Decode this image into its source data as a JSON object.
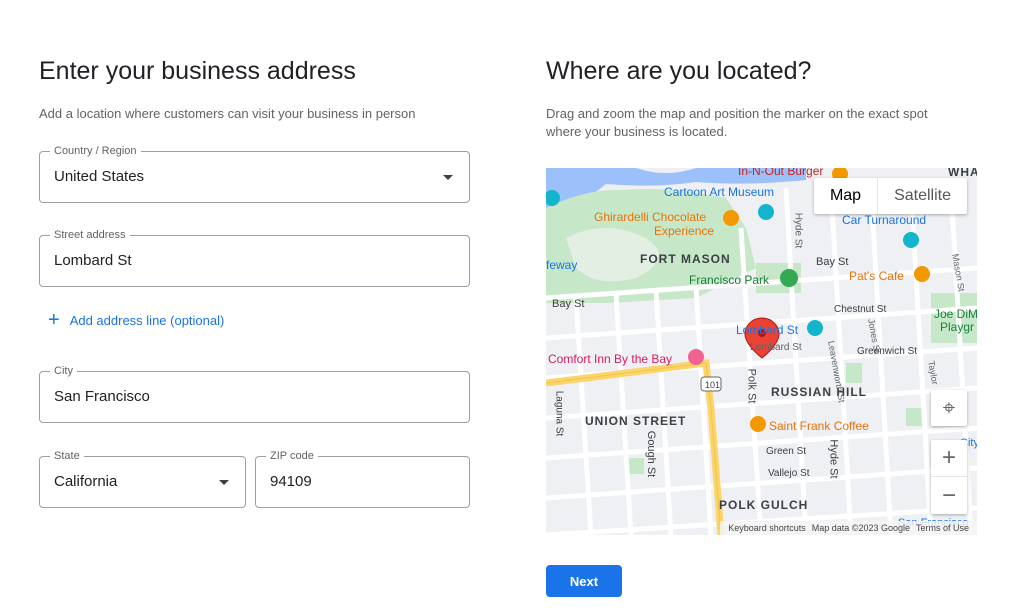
{
  "left": {
    "title": "Enter your business address",
    "subtitle": "Add a location where customers can visit your business in person",
    "country": {
      "label": "Country / Region",
      "value": "United States"
    },
    "street": {
      "label": "Street address",
      "value": "Lombard St"
    },
    "add_line": "Add address line (optional)",
    "city": {
      "label": "City",
      "value": "San Francisco"
    },
    "state": {
      "label": "State",
      "value": "California"
    },
    "zip": {
      "label": "ZIP code",
      "value": "94109"
    }
  },
  "right": {
    "title": "Where are you located?",
    "subtitle": "Drag and zoom the map and position the marker on the exact spot where your business is located.",
    "map": {
      "toggle_map": "Map",
      "toggle_satellite": "Satellite",
      "labels": {
        "in_n_out": "In-N-Out Burger",
        "cartoon": "Cartoon Art Museum",
        "wha": "WHA",
        "ghirardelli_1": "Ghirardelli Chocolate",
        "ghirardelli_2": "Experience",
        "car_turnaround": "Car Turnaround",
        "feway": "feway",
        "fort_mason": "FORT MASON",
        "bay_st_1": "Bay St",
        "francisco_park": "Francisco Park",
        "pats_cafe": "Pat's Cafe",
        "bay_st_2": "Bay St",
        "chestnut": "Chestnut St",
        "lombard_1": "Lombard St",
        "lombard_2": "Lombard St",
        "joe": "Joe DiM",
        "playg": "Playgr",
        "comfort_inn": "Comfort Inn By the Bay",
        "greenwich": "Greenwich St",
        "hwy": "101",
        "polk_st": "Polk St",
        "russian_hill": "RUSSIAN HILL",
        "laguna": "Laguna St",
        "union_street": "UNION STREET",
        "saint_frank": "Saint Frank Coffee",
        "gough": "Gough St",
        "green_st": "Green St",
        "hyde_st": "Hyde St",
        "hyde_st_top": "Hyde St",
        "vallejo": "Vallejo St",
        "leavenworth": "Leavenworth St",
        "jones": "Jones St",
        "mason": "Mason St",
        "taylor": "Taylor",
        "polk_gulch": "POLK GULCH",
        "san_francisco": "San Francisco",
        "city": "City"
      },
      "attribution": {
        "shortcuts": "Keyboard shortcuts",
        "data": "Map data ©2023 Google",
        "terms": "Terms of Use"
      }
    },
    "next_label": "Next"
  }
}
